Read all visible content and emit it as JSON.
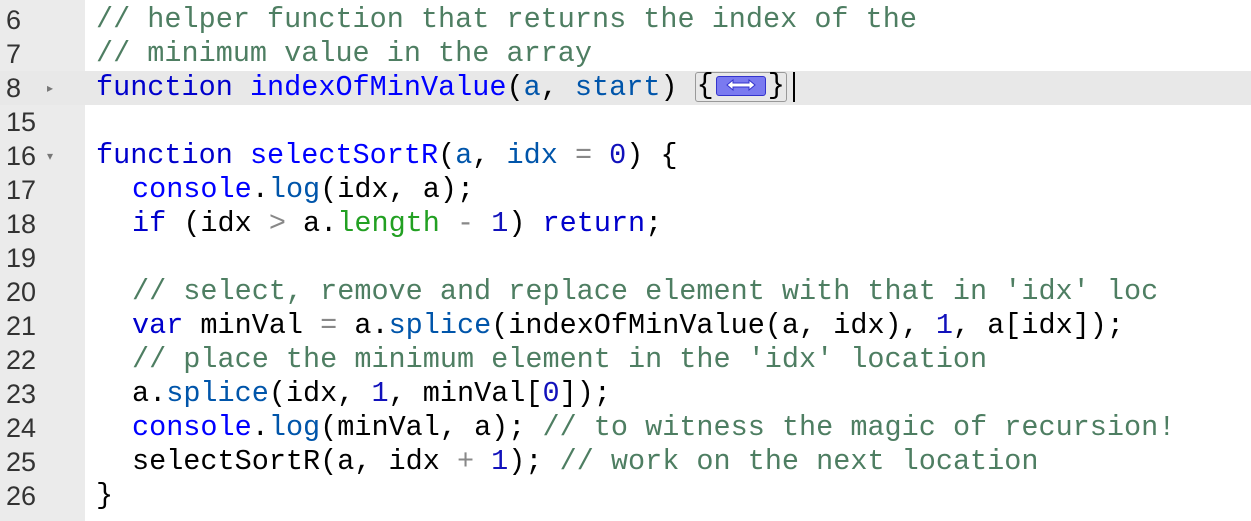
{
  "editor": {
    "lines": [
      {
        "num": "6",
        "fold": "",
        "indent": 0,
        "tokens": [
          {
            "c": "cmt",
            "t": "// helper function that returns the index of the"
          }
        ]
      },
      {
        "num": "7",
        "fold": "",
        "indent": 0,
        "tokens": [
          {
            "c": "cmt",
            "t": "// minimum value in the array"
          }
        ]
      },
      {
        "num": "8",
        "fold": "▸",
        "indent": 0,
        "active": true,
        "folded": true,
        "tokens": [
          {
            "c": "kw",
            "t": "function"
          },
          {
            "c": "punc",
            "t": " "
          },
          {
            "c": "def",
            "t": "indexOfMinValue"
          },
          {
            "c": "punc",
            "t": "("
          },
          {
            "c": "prop",
            "t": "a"
          },
          {
            "c": "punc",
            "t": ", "
          },
          {
            "c": "prop",
            "t": "start"
          },
          {
            "c": "punc",
            "t": ") "
          }
        ],
        "fold_open": "{",
        "fold_close": "}"
      },
      {
        "num": "15",
        "fold": "",
        "indent": 0,
        "tokens": []
      },
      {
        "num": "16",
        "fold": "▾",
        "indent": 0,
        "tokens": [
          {
            "c": "kw",
            "t": "function"
          },
          {
            "c": "punc",
            "t": " "
          },
          {
            "c": "def",
            "t": "selectSortR"
          },
          {
            "c": "punc",
            "t": "("
          },
          {
            "c": "prop",
            "t": "a"
          },
          {
            "c": "punc",
            "t": ", "
          },
          {
            "c": "prop",
            "t": "idx"
          },
          {
            "c": "punc",
            "t": " "
          },
          {
            "c": "op",
            "t": "="
          },
          {
            "c": "punc",
            "t": " "
          },
          {
            "c": "num",
            "t": "0"
          },
          {
            "c": "punc",
            "t": ") {"
          }
        ]
      },
      {
        "num": "17",
        "fold": "",
        "indent": 1,
        "tokens": [
          {
            "c": "def",
            "t": "console"
          },
          {
            "c": "punc",
            "t": "."
          },
          {
            "c": "prop",
            "t": "log"
          },
          {
            "c": "punc",
            "t": "(idx, a);"
          }
        ]
      },
      {
        "num": "18",
        "fold": "",
        "indent": 1,
        "tokens": [
          {
            "c": "kw",
            "t": "if"
          },
          {
            "c": "punc",
            "t": " (idx "
          },
          {
            "c": "op",
            "t": ">"
          },
          {
            "c": "punc",
            "t": " a."
          },
          {
            "c": "bi",
            "t": "length"
          },
          {
            "c": "punc",
            "t": " "
          },
          {
            "c": "op",
            "t": "-"
          },
          {
            "c": "punc",
            "t": " "
          },
          {
            "c": "num",
            "t": "1"
          },
          {
            "c": "punc",
            "t": ") "
          },
          {
            "c": "kw",
            "t": "return"
          },
          {
            "c": "punc",
            "t": ";"
          }
        ]
      },
      {
        "num": "19",
        "fold": "",
        "indent": 0,
        "tokens": []
      },
      {
        "num": "20",
        "fold": "",
        "indent": 1,
        "tokens": [
          {
            "c": "cmt",
            "t": "// select, remove and replace element with that in 'idx' loc"
          }
        ]
      },
      {
        "num": "21",
        "fold": "",
        "indent": 1,
        "tokens": [
          {
            "c": "kw",
            "t": "var"
          },
          {
            "c": "punc",
            "t": " minVal "
          },
          {
            "c": "op",
            "t": "="
          },
          {
            "c": "punc",
            "t": " a."
          },
          {
            "c": "prop",
            "t": "splice"
          },
          {
            "c": "punc",
            "t": "(indexOfMinValue(a, idx), "
          },
          {
            "c": "num",
            "t": "1"
          },
          {
            "c": "punc",
            "t": ", a[idx]);"
          }
        ]
      },
      {
        "num": "22",
        "fold": "",
        "indent": 1,
        "tokens": [
          {
            "c": "cmt",
            "t": "// place the minimum element in the 'idx' location"
          }
        ]
      },
      {
        "num": "23",
        "fold": "",
        "indent": 1,
        "tokens": [
          {
            "c": "punc",
            "t": "a."
          },
          {
            "c": "prop",
            "t": "splice"
          },
          {
            "c": "punc",
            "t": "(idx, "
          },
          {
            "c": "num",
            "t": "1"
          },
          {
            "c": "punc",
            "t": ", minVal["
          },
          {
            "c": "num",
            "t": "0"
          },
          {
            "c": "punc",
            "t": "]);"
          }
        ]
      },
      {
        "num": "24",
        "fold": "",
        "indent": 1,
        "tokens": [
          {
            "c": "def",
            "t": "console"
          },
          {
            "c": "punc",
            "t": "."
          },
          {
            "c": "prop",
            "t": "log"
          },
          {
            "c": "punc",
            "t": "(minVal, a); "
          },
          {
            "c": "cmt",
            "t": "// to witness the magic of recursion!"
          }
        ]
      },
      {
        "num": "25",
        "fold": "",
        "indent": 1,
        "tokens": [
          {
            "c": "punc",
            "t": "selectSortR(a, idx "
          },
          {
            "c": "op",
            "t": "+"
          },
          {
            "c": "punc",
            "t": " "
          },
          {
            "c": "num",
            "t": "1"
          },
          {
            "c": "punc",
            "t": "); "
          },
          {
            "c": "cmt",
            "t": "// work on the next location"
          }
        ]
      },
      {
        "num": "26",
        "fold": "",
        "indent": 0,
        "tokens": [
          {
            "c": "punc",
            "t": "}"
          }
        ]
      }
    ]
  },
  "colors": {
    "keyword": "#0000cc",
    "comment": "#4e7e62",
    "number": "#1111bb",
    "builtin": "#22a022",
    "gutter": "#ebebeb",
    "active_line": "#e8e8e8",
    "fold_marker": "#7a7af0"
  },
  "icons": {
    "fold_collapsed": "triangle-right-icon",
    "fold_expanded": "triangle-down-icon",
    "folded_code": "double-arrow-icon"
  }
}
